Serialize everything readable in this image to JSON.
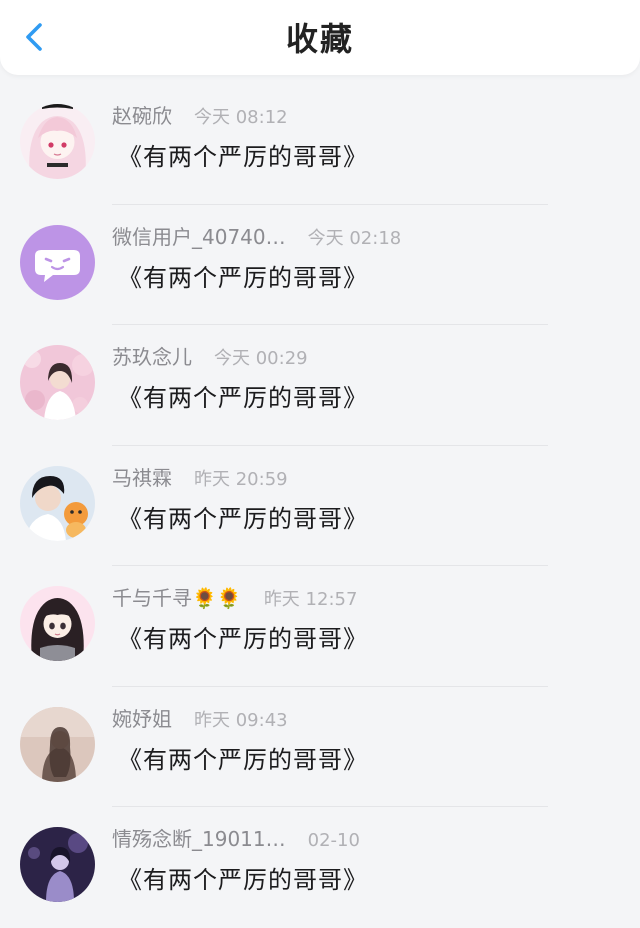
{
  "header": {
    "title": "收藏",
    "back_icon": "chevron-left-icon",
    "accent_color": "#2f9bf2"
  },
  "items": [
    {
      "name": "赵碗欣",
      "time": "今天 08:12",
      "content": "《有两个严厉的哥哥》",
      "avatar": "pink-hair-anime-girl-avatar"
    },
    {
      "name": "微信用户_40740…",
      "time": "今天 02:18",
      "content": "《有两个严厉的哥哥》",
      "avatar": "default-purple-chat-avatar"
    },
    {
      "name": "苏玖念儿",
      "time": "今天 00:29",
      "content": "《有两个严厉的哥哥》",
      "avatar": "pink-blossom-girl-avatar"
    },
    {
      "name": "马祺霖",
      "time": "昨天 20:59",
      "content": "《有两个严厉的哥哥》",
      "avatar": "boy-with-orange-toy-avatar"
    },
    {
      "name": "千与千寻🌻🌻",
      "time": "昨天 12:57",
      "content": "《有两个严厉的哥哥》",
      "avatar": "anime-girl-black-hair-avatar"
    },
    {
      "name": "婉妤姐",
      "time": "昨天 09:43",
      "content": "《有两个严厉的哥哥》",
      "avatar": "sepia-girl-avatar"
    },
    {
      "name": "情殇念断_19011…",
      "time": "02-10",
      "content": "《有两个严厉的哥哥》",
      "avatar": "dark-purple-figure-avatar"
    }
  ]
}
